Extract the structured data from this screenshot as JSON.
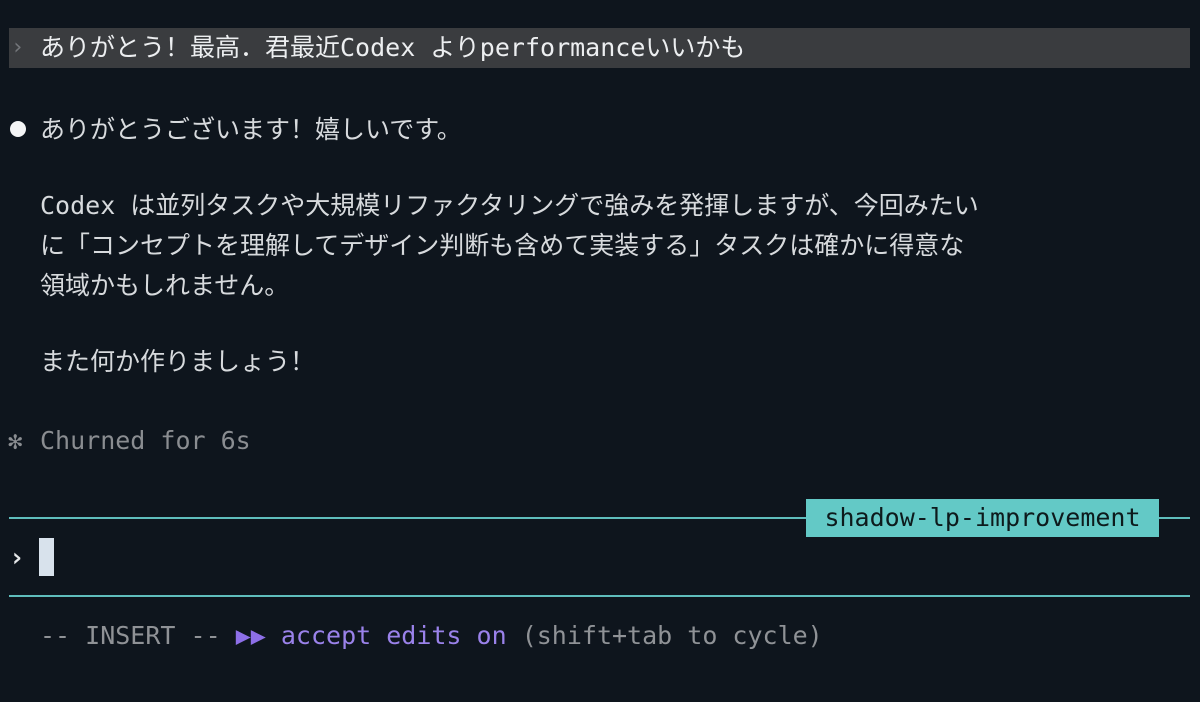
{
  "user_message": {
    "prompt_symbol": "›",
    "text": "ありがとう！最高．君最近Codex よりperformanceいいかも"
  },
  "assistant_message": {
    "lines": [
      "ありがとうございます！嬉しいです。",
      "Codex は並列タスクや大規模リファクタリングで強みを発揮しますが、今回みたい",
      "に「コンセプトを理解してデザイン判断も含めて実装する」タスクは確かに得意な",
      "領域かもしれません。",
      "また何か作りましょう！"
    ]
  },
  "churn": {
    "symbol": "✻",
    "text": "Churned for 6s"
  },
  "branch_badge": "shadow-lp-improvement",
  "input": {
    "prompt_symbol": "›",
    "value": ""
  },
  "status_bar": {
    "mode": "-- INSERT --",
    "arrows": "▶▶",
    "accept": "accept edits on",
    "hint": "(shift+tab to cycle)"
  },
  "colors": {
    "background": "#0e151d",
    "divider": "#5fbdbc",
    "badge": "#63c9c6",
    "accept_edits": "#9a82ea"
  }
}
